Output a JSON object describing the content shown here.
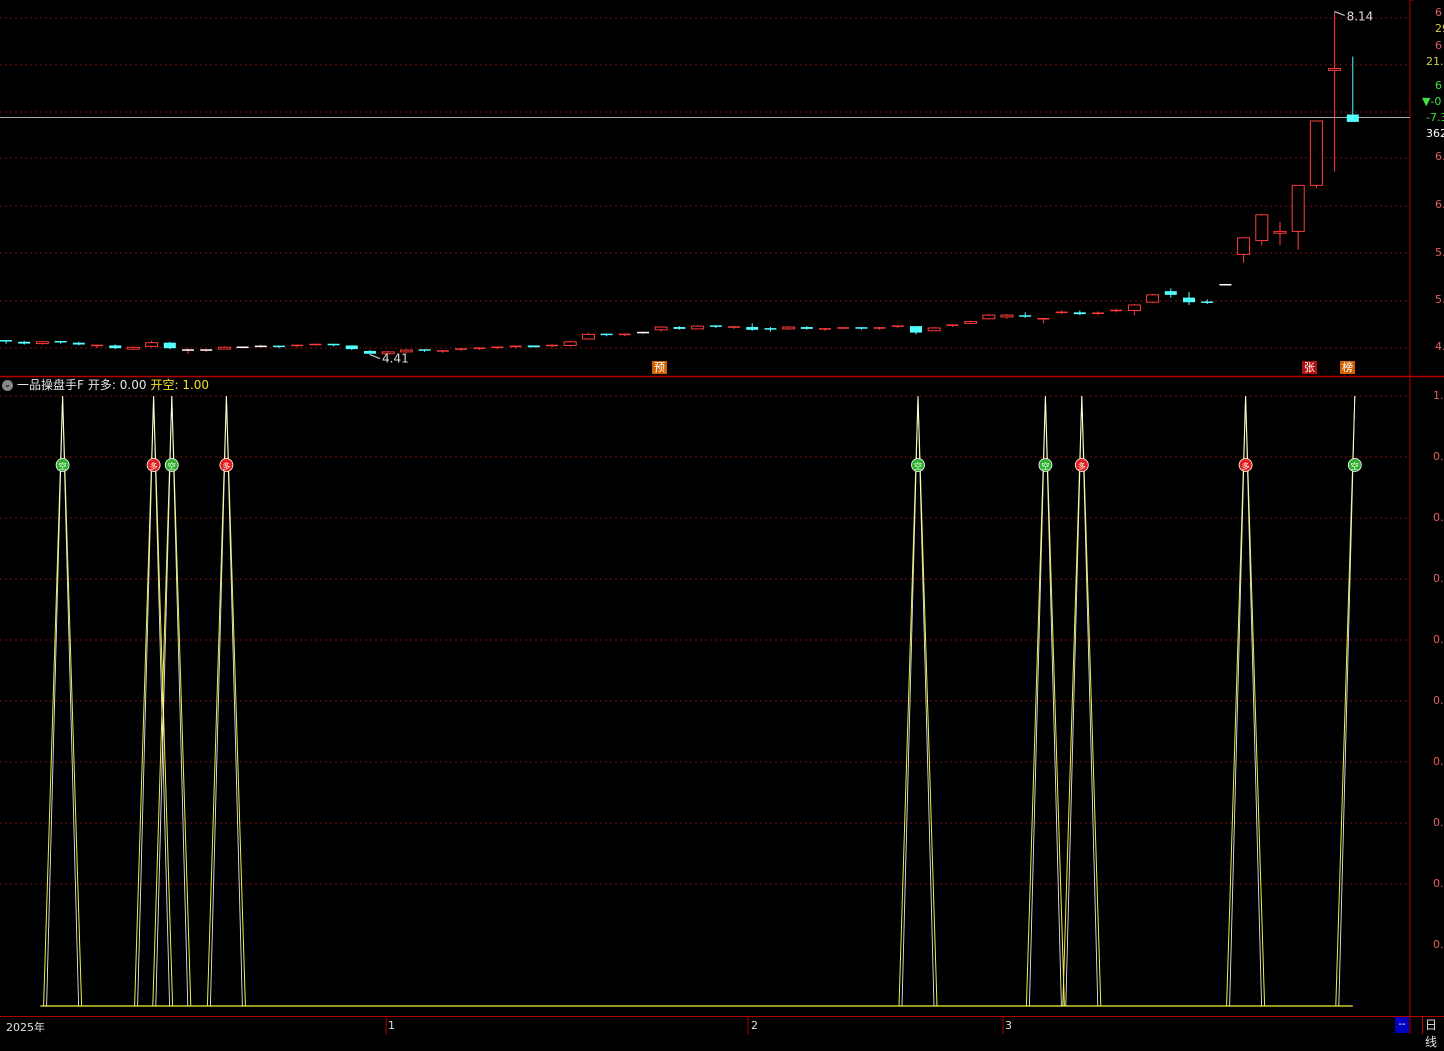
{
  "main_chart": {
    "high_label": "8.14",
    "low_label": "4.41",
    "price_axis": {
      "ticks": [
        {
          "text": "6",
          "color": "#e06060"
        },
        {
          "text": "29",
          "color": "#d0d040"
        },
        {
          "text": "6",
          "color": "#e06060"
        },
        {
          "text": "21.",
          "color": "#d0d040"
        },
        {
          "text": "6",
          "color": "#40e040"
        },
        {
          "text": "▼-0",
          "color": "#40e040"
        },
        {
          "text": "-7.3",
          "color": "#40e040"
        },
        {
          "text": "362",
          "color": "#ffffff"
        },
        {
          "text": "6.",
          "color": "#e06060"
        },
        {
          "text": "6.",
          "color": "#e06060"
        },
        {
          "text": "5.",
          "color": "#e06060"
        },
        {
          "text": "5.",
          "color": "#e06060"
        },
        {
          "text": "4.",
          "color": "#e06060"
        }
      ]
    },
    "markers": [
      {
        "text": "预",
        "bg": "#d06000"
      },
      {
        "text": "张",
        "bg": "#b01010"
      },
      {
        "text": "榜",
        "bg": "#d06000"
      }
    ]
  },
  "indicator": {
    "name": "一品操盘手F",
    "duo_label": "开多: 0.00",
    "kong_label": "开空: 1.00",
    "axis_ticks": [
      "1.",
      "0.",
      "0.",
      "0.",
      "0.",
      "0.",
      "0.",
      "0.",
      "0.",
      "0."
    ],
    "signal_duo_text": "多",
    "signal_kong_text": "空"
  },
  "time_axis": {
    "labels": [
      "2025年",
      "1",
      "2",
      "3"
    ]
  },
  "period_tab": "日线",
  "scroll_button": "--",
  "colors": {
    "up": "#ff3c3c",
    "down": "#54ffff",
    "grid": "#7a1010",
    "border": "#b00000",
    "yellow": "#f0f040",
    "white": "#ffffff"
  },
  "chart_data": {
    "type": "table",
    "candles_ohlc": [
      [
        4.56,
        4.57,
        4.53,
        4.55
      ],
      [
        4.55,
        4.56,
        4.52,
        4.53
      ],
      [
        4.53,
        4.56,
        4.52,
        4.55
      ],
      [
        4.55,
        4.56,
        4.53,
        4.54
      ],
      [
        4.54,
        4.55,
        4.51,
        4.52
      ],
      [
        4.5,
        4.52,
        4.48,
        4.51
      ],
      [
        4.51,
        4.52,
        4.47,
        4.48
      ],
      [
        4.47,
        4.5,
        4.46,
        4.49
      ],
      [
        4.5,
        4.56,
        4.49,
        4.54
      ],
      [
        4.54,
        4.55,
        4.47,
        4.48
      ],
      [
        4.46,
        4.48,
        4.42,
        4.46
      ],
      [
        4.46,
        4.47,
        4.44,
        4.46
      ],
      [
        4.47,
        4.5,
        4.47,
        4.49
      ],
      [
        4.49,
        4.5,
        4.48,
        4.49
      ],
      [
        4.5,
        4.52,
        4.49,
        4.5
      ],
      [
        4.5,
        4.51,
        4.48,
        4.49
      ],
      [
        4.5,
        4.52,
        4.49,
        4.51
      ],
      [
        4.51,
        4.53,
        4.51,
        4.52
      ],
      [
        4.52,
        4.53,
        4.5,
        4.51
      ],
      [
        4.51,
        4.51,
        4.46,
        4.47
      ],
      [
        4.45,
        4.46,
        4.41,
        4.42
      ],
      [
        4.42,
        4.45,
        4.42,
        4.44
      ],
      [
        4.44,
        4.47,
        4.43,
        4.46
      ],
      [
        4.46,
        4.47,
        4.44,
        4.45
      ],
      [
        4.44,
        4.46,
        4.43,
        4.45
      ],
      [
        4.46,
        4.48,
        4.45,
        4.47
      ],
      [
        4.47,
        4.49,
        4.46,
        4.48
      ],
      [
        4.48,
        4.5,
        4.47,
        4.49
      ],
      [
        4.49,
        4.51,
        4.48,
        4.5
      ],
      [
        4.51,
        4.51,
        4.49,
        4.49
      ],
      [
        4.5,
        4.52,
        4.49,
        4.51
      ],
      [
        4.51,
        4.56,
        4.5,
        4.55
      ],
      [
        4.58,
        4.65,
        4.58,
        4.63
      ],
      [
        4.63,
        4.64,
        4.61,
        4.62
      ],
      [
        4.62,
        4.64,
        4.61,
        4.63
      ],
      [
        4.65,
        4.66,
        4.63,
        4.65
      ],
      [
        4.68,
        4.72,
        4.66,
        4.71
      ],
      [
        4.71,
        4.72,
        4.68,
        4.69
      ],
      [
        4.69,
        4.73,
        4.69,
        4.72
      ],
      [
        4.72,
        4.73,
        4.7,
        4.71
      ],
      [
        4.7,
        4.72,
        4.69,
        4.71
      ],
      [
        4.71,
        4.75,
        4.67,
        4.68
      ],
      [
        4.69,
        4.71,
        4.66,
        4.68
      ],
      [
        4.69,
        4.72,
        4.68,
        4.71
      ],
      [
        4.71,
        4.72,
        4.68,
        4.69
      ],
      [
        4.68,
        4.7,
        4.67,
        4.69
      ],
      [
        4.69,
        4.71,
        4.69,
        4.7
      ],
      [
        4.7,
        4.71,
        4.68,
        4.69
      ],
      [
        4.69,
        4.71,
        4.68,
        4.7
      ],
      [
        4.71,
        4.72,
        4.7,
        4.72
      ],
      [
        4.72,
        4.72,
        4.63,
        4.65
      ],
      [
        4.67,
        4.71,
        4.67,
        4.7
      ],
      [
        4.72,
        4.74,
        4.71,
        4.73
      ],
      [
        4.75,
        4.78,
        4.74,
        4.77
      ],
      [
        4.8,
        4.85,
        4.79,
        4.84
      ],
      [
        4.82,
        4.85,
        4.8,
        4.84
      ],
      [
        4.83,
        4.87,
        4.81,
        4.82
      ],
      [
        4.79,
        4.81,
        4.75,
        4.8
      ],
      [
        4.86,
        4.89,
        4.85,
        4.87
      ],
      [
        4.87,
        4.89,
        4.84,
        4.85
      ],
      [
        4.85,
        4.88,
        4.84,
        4.86
      ],
      [
        4.88,
        4.91,
        4.87,
        4.89
      ],
      [
        4.89,
        4.96,
        4.84,
        4.95
      ],
      [
        4.98,
        5.07,
        4.97,
        5.06
      ],
      [
        5.1,
        5.13,
        5.03,
        5.06
      ],
      [
        5.03,
        5.09,
        4.95,
        4.98
      ],
      [
        4.98,
        5.01,
        4.96,
        4.97
      ],
      [
        5.17,
        5.17,
        5.17,
        5.17
      ],
      [
        5.5,
        5.6,
        5.41,
        5.68
      ],
      [
        5.65,
        5.94,
        5.6,
        5.93
      ],
      [
        5.73,
        5.85,
        5.6,
        5.75
      ],
      [
        5.75,
        6.0,
        5.55,
        6.25
      ],
      [
        6.25,
        6.55,
        6.22,
        6.95
      ],
      [
        7.5,
        8.14,
        6.4,
        7.52
      ],
      [
        7.02,
        7.65,
        6.95,
        6.94
      ]
    ],
    "indicator_signal_bars": [
      3,
      8,
      9,
      12,
      50,
      57,
      59,
      68,
      74
    ],
    "indicator_signal_types": [
      "kong",
      "duo",
      "kong",
      "duo",
      "kong",
      "kong",
      "duo",
      "duo",
      "kong"
    ]
  }
}
